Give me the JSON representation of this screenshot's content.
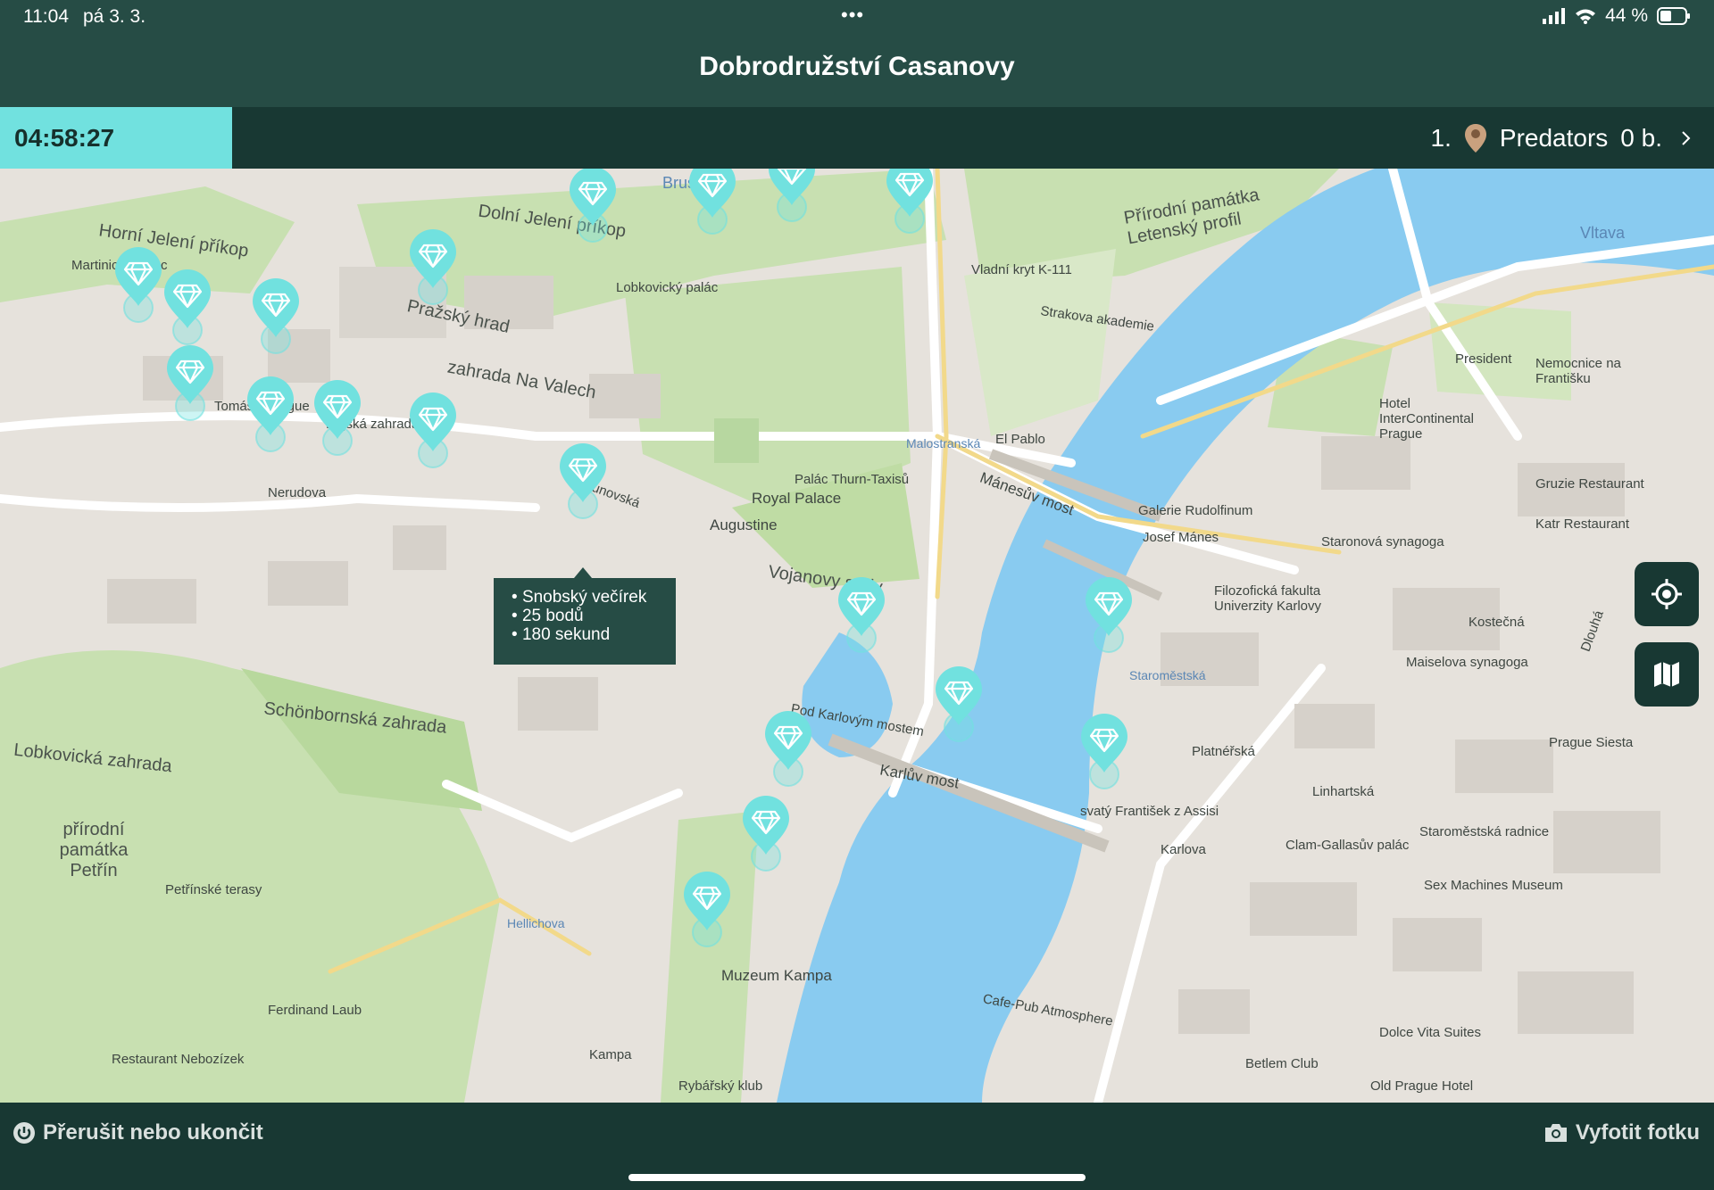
{
  "status_bar": {
    "time": "11:04",
    "date": "pá 3. 3.",
    "battery_text": "44 %"
  },
  "header": {
    "title": "Dobrodružství Casanovy"
  },
  "info_bar": {
    "timer": "04:58:27",
    "rank": "1.",
    "team_name": "Predators",
    "points": "0 b."
  },
  "tooltip": {
    "name": "Snobský večírek",
    "points": "25 bodů",
    "duration": "180 sekund"
  },
  "map_labels": [
    "Horní Jelení příkop",
    "Dolní Jelení příkop",
    "Pražský hrad",
    "zahrada Na Valech",
    "Vojanovy sady",
    "Schönbornská zahrada",
    "Lobkovická zahrada",
    "přírodní památka Petřín",
    "Přírodní památka Letenský profil",
    "Brusnice",
    "Vltava",
    "Mánesův most",
    "Karlův most",
    "Staroměstská",
    "Malostranská",
    "Hellichova",
    "Muzeum Kampa",
    "Strakova akademie",
    "Nerudova",
    "Thunovská",
    "Royal Palace",
    "Augustine",
    "Lobkovický palác",
    "Martinický palác",
    "Rajská zahrada",
    "Tomáš Garrigue",
    "Hotel InterContinental Prague",
    "Galerie Rudolfinum",
    "Josef Mánes",
    "Staronová synagoga",
    "Maiselova synagoga",
    "Filozofická fakulta Univerzity Karlovy",
    "Clam-Gallasův palác",
    "Staroměstská radnice",
    "Sex Machines Museum",
    "Petřínské terasy",
    "Ferdinand Laub",
    "Restaurant Nebozízek",
    "Kampa",
    "Rybářský klub",
    "Pod Karlovým mostem",
    "Cafe-Pub Atmosphere",
    "Betlem Club",
    "Old Prague Hotel",
    "Dolce Vita Suites",
    "svatý František z Assisi",
    "Platnéřská",
    "Karlova",
    "Linhartská",
    "Kostečná",
    "Dlouhá",
    "Prague Siesta",
    "Katr Restaurant",
    "Gruzie Restaurant",
    "President",
    "Nemocnice na Františku",
    "El Pablo",
    "Vladní kryt K-111",
    "Palác Thurn-Taxisů"
  ],
  "pins_count": 20,
  "bottom_bar": {
    "quit_label": "Přerušit nebo ukončit",
    "photo_label": "Vyfotit fotku"
  },
  "colors": {
    "header_bg": "#264c45",
    "bar_bg": "#183833",
    "accent": "#71e1df",
    "water": "#89cbf0",
    "park": "#c9e2b3"
  },
  "icons": {
    "battery": "battery-icon",
    "wifi": "wifi-icon",
    "signal": "signal-icon",
    "team": "location-pin-icon",
    "chevron": "chevron-right-icon",
    "locate": "crosshair-icon",
    "map": "map-icon",
    "power": "power-icon",
    "camera": "camera-icon",
    "pin": "diamond-pin-icon"
  }
}
